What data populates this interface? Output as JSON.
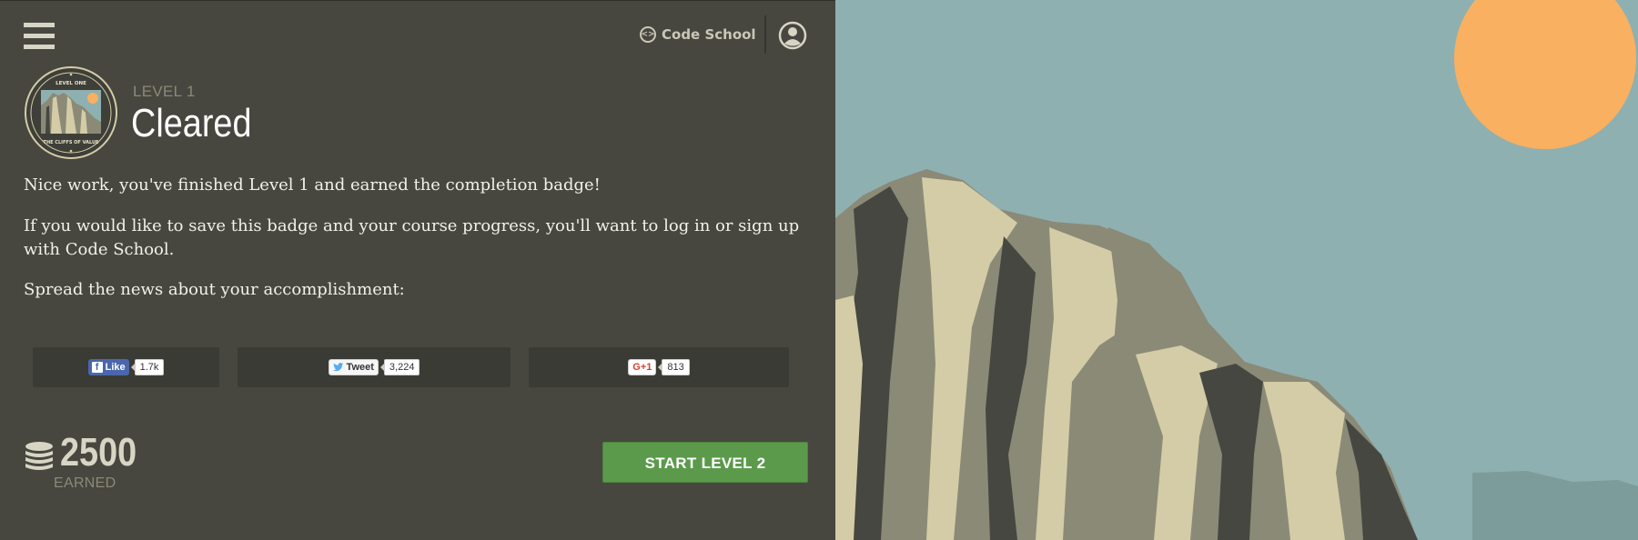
{
  "header": {
    "menu_icon": "hamburger-menu-icon",
    "brand_name": "Code School",
    "brand_icon_glyph": "<>",
    "account_icon": "user-circle-icon"
  },
  "badge": {
    "top_text": "LEVEL ONE",
    "bottom_text": "THE CLIFFS OF VALUE"
  },
  "result": {
    "level_label": "LEVEL 1",
    "status": "Cleared"
  },
  "messages": {
    "completion": "Nice work, you've finished Level 1 and earned the completion badge!",
    "save_prompt": "If you would like to save this badge and your course progress, you'll want to log in or sign up with Code School.",
    "share_prompt": "Spread the news about your accomplishment:"
  },
  "share": {
    "facebook": {
      "label": "Like",
      "glyph": "f",
      "count": "1.7k"
    },
    "twitter": {
      "label": "Tweet",
      "count": "3,224"
    },
    "google_plus": {
      "label": "G+1",
      "count": "813"
    }
  },
  "points": {
    "value": "2500",
    "label": "EARNED"
  },
  "actions": {
    "next_level": "START LEVEL 2"
  },
  "colors": {
    "panel": "#474740",
    "sky": "#8fb0b0",
    "sun": "#f9b061",
    "button": "#5b9a4b",
    "rock_light": "#d4cca6",
    "rock_mid": "#8a8a77",
    "rock_dark": "#464741"
  }
}
